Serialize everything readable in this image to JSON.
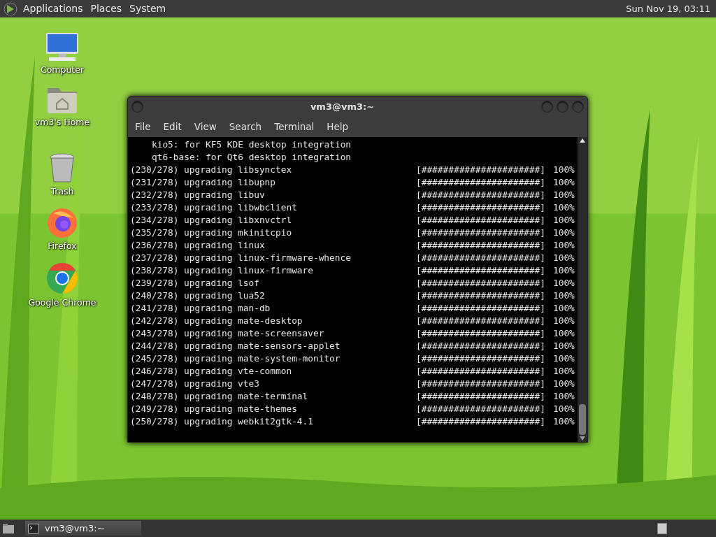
{
  "top_panel": {
    "menus": [
      {
        "label": "Applications"
      },
      {
        "label": "Places"
      },
      {
        "label": "System"
      }
    ],
    "clock": "Sun Nov 19, 03:11"
  },
  "desktop_icons": [
    {
      "kind": "computer",
      "label": "Computer"
    },
    {
      "kind": "home",
      "label": "vm3's Home"
    },
    {
      "kind": "trash",
      "label": "Trash"
    },
    {
      "kind": "firefox",
      "label": "Firefox"
    },
    {
      "kind": "chrome",
      "label": "Google Chrome"
    }
  ],
  "terminal": {
    "title": "vm3@vm3:~",
    "menu": [
      {
        "label": "File"
      },
      {
        "label": "Edit"
      },
      {
        "label": "View"
      },
      {
        "label": "Search"
      },
      {
        "label": "Terminal"
      },
      {
        "label": "Help"
      }
    ],
    "lines": [
      {
        "kind": "note",
        "text": "kio5: for KF5 KDE desktop integration"
      },
      {
        "kind": "note",
        "text": "qt6-base: for Qt6 desktop integration"
      },
      {
        "kind": "progress",
        "text": "(230/278) upgrading libsynctex",
        "bar": "[######################]",
        "percent": "100%"
      },
      {
        "kind": "progress",
        "text": "(231/278) upgrading libupnp",
        "bar": "[######################]",
        "percent": "100%"
      },
      {
        "kind": "progress",
        "text": "(232/278) upgrading libuv",
        "bar": "[######################]",
        "percent": "100%"
      },
      {
        "kind": "progress",
        "text": "(233/278) upgrading libwbclient",
        "bar": "[######################]",
        "percent": "100%"
      },
      {
        "kind": "progress",
        "text": "(234/278) upgrading libxnvctrl",
        "bar": "[######################]",
        "percent": "100%"
      },
      {
        "kind": "progress",
        "text": "(235/278) upgrading mkinitcpio",
        "bar": "[######################]",
        "percent": "100%"
      },
      {
        "kind": "progress",
        "text": "(236/278) upgrading linux",
        "bar": "[######################]",
        "percent": "100%"
      },
      {
        "kind": "progress",
        "text": "(237/278) upgrading linux-firmware-whence",
        "bar": "[######################]",
        "percent": "100%"
      },
      {
        "kind": "progress",
        "text": "(238/278) upgrading linux-firmware",
        "bar": "[######################]",
        "percent": "100%"
      },
      {
        "kind": "progress",
        "text": "(239/278) upgrading lsof",
        "bar": "[######################]",
        "percent": "100%"
      },
      {
        "kind": "progress",
        "text": "(240/278) upgrading lua52",
        "bar": "[######################]",
        "percent": "100%"
      },
      {
        "kind": "progress",
        "text": "(241/278) upgrading man-db",
        "bar": "[######################]",
        "percent": "100%"
      },
      {
        "kind": "progress",
        "text": "(242/278) upgrading mate-desktop",
        "bar": "[######################]",
        "percent": "100%"
      },
      {
        "kind": "progress",
        "text": "(243/278) upgrading mate-screensaver",
        "bar": "[######################]",
        "percent": "100%"
      },
      {
        "kind": "progress",
        "text": "(244/278) upgrading mate-sensors-applet",
        "bar": "[######################]",
        "percent": "100%"
      },
      {
        "kind": "progress",
        "text": "(245/278) upgrading mate-system-monitor",
        "bar": "[######################]",
        "percent": "100%"
      },
      {
        "kind": "progress",
        "text": "(246/278) upgrading vte-common",
        "bar": "[######################]",
        "percent": "100%"
      },
      {
        "kind": "progress",
        "text": "(247/278) upgrading vte3",
        "bar": "[######################]",
        "percent": "100%"
      },
      {
        "kind": "progress",
        "text": "(248/278) upgrading mate-terminal",
        "bar": "[######################]",
        "percent": "100%"
      },
      {
        "kind": "progress",
        "text": "(249/278) upgrading mate-themes",
        "bar": "[######################]",
        "percent": "100%"
      },
      {
        "kind": "progress",
        "text": "(250/278) upgrading webkit2gtk-4.1",
        "bar": "[######################]",
        "percent": "100%"
      }
    ]
  },
  "taskbar": {
    "tasks": [
      {
        "label": "vm3@vm3:~",
        "selected": true
      }
    ]
  }
}
